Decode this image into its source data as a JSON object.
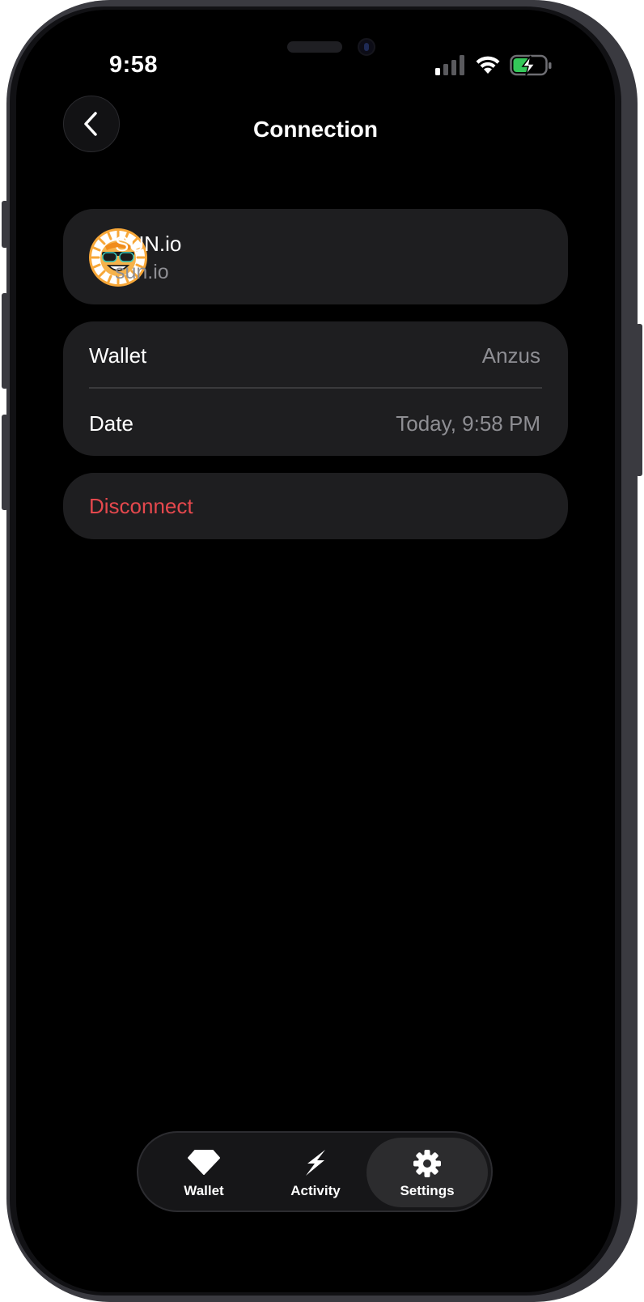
{
  "status_bar": {
    "time": "9:58",
    "icons": [
      "signal-icon",
      "wifi-icon",
      "battery-charging-icon"
    ],
    "battery_color": "#34c759"
  },
  "header": {
    "title": "Connection",
    "back_icon": "chevron-left-icon"
  },
  "dapp": {
    "name": "SUN.io",
    "url": "sun.io",
    "logo_icon": "sun-with-sunglasses-logo"
  },
  "details": {
    "rows": [
      {
        "label": "Wallet",
        "value": "Anzus"
      },
      {
        "label": "Date",
        "value": "Today, 9:58 PM"
      }
    ]
  },
  "disconnect": {
    "label": "Disconnect",
    "color": "#e5484d"
  },
  "tabbar": {
    "active": "Settings",
    "tabs": [
      {
        "label": "Wallet",
        "icon": "diamond-icon"
      },
      {
        "label": "Activity",
        "icon": "lightning-icon"
      },
      {
        "label": "Settings",
        "icon": "gear-icon"
      }
    ]
  }
}
